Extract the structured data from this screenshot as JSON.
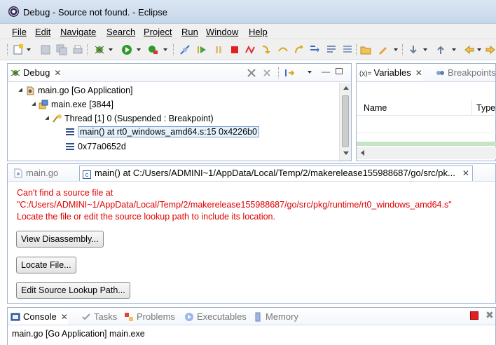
{
  "window": {
    "title": "Debug - Source not found. - Eclipse"
  },
  "menu": [
    {
      "label": "File"
    },
    {
      "label": "Edit"
    },
    {
      "label": "Navigate"
    },
    {
      "label": "Search"
    },
    {
      "label": "Project"
    },
    {
      "label": "Run"
    },
    {
      "label": "Window"
    },
    {
      "label": "Help"
    }
  ],
  "debug_view": {
    "tab_label": "Debug",
    "tree": {
      "root": "main.go [Go Application]",
      "process": "main.exe [3844]",
      "thread": "Thread [1] 0 (Suspended : Breakpoint)",
      "frame_selected": "main() at rt0_windows_amd64.s:15 0x4226b0",
      "frame_other": "0x77a0652d"
    }
  },
  "variables_view": {
    "tab_variables": "Variables",
    "tab_breakpoints": "Breakpoints",
    "col_name": "Name",
    "col_type": "Type"
  },
  "editor": {
    "tab_main": "main.go",
    "tab_active": "main() at C:/Users/ADMINI~1/AppData/Local/Temp/2/makerelease155988687/go/src/pk...",
    "error_line1": "Can't find a source file at",
    "error_line2": "\"C:/Users/ADMINI~1/AppData/Local/Temp/2/makerelease155988687/go/src/pkg/runtime/rt0_windows_amd64.s\"",
    "error_line3": "Locate the file or edit the source lookup path to include its location.",
    "btn_disassembly": "View Disassembly...",
    "btn_locate": "Locate File...",
    "btn_lookup": "Edit Source Lookup Path..."
  },
  "console": {
    "tab_console": "Console",
    "tab_tasks": "Tasks",
    "tab_problems": "Problems",
    "tab_executables": "Executables",
    "tab_memory": "Memory",
    "status": "main.go [Go Application] main.exe"
  },
  "colors": {
    "error_red": "#e00000",
    "selection_blue": "#e5f1fb",
    "panel_border": "#a0b4cf"
  }
}
